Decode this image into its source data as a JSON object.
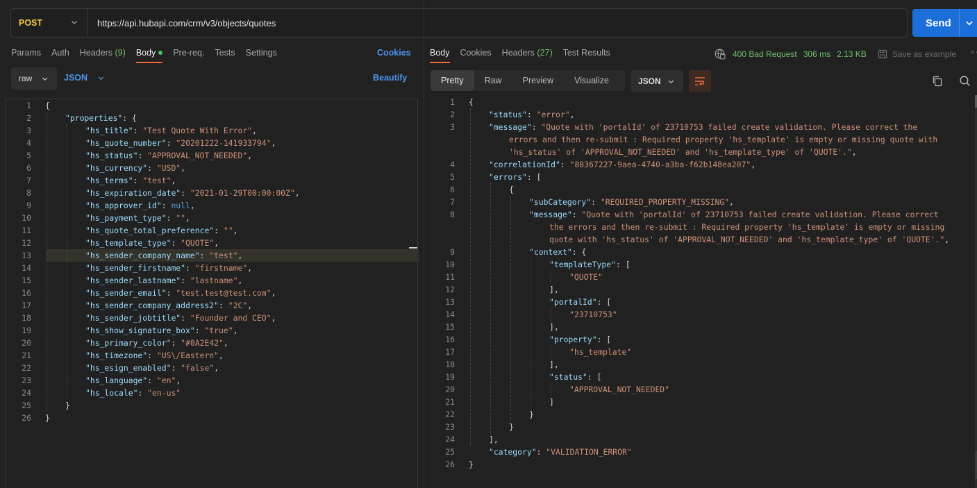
{
  "request": {
    "method": "POST",
    "url": "https://api.hubapi.com/crm/v3/objects/quotes",
    "send_label": "Send"
  },
  "request_tabs": [
    {
      "label": "Params"
    },
    {
      "label": "Auth"
    },
    {
      "label": "Headers",
      "count": "(9)"
    },
    {
      "label": "Body",
      "active": true
    },
    {
      "label": "Pre-req."
    },
    {
      "label": "Tests"
    },
    {
      "label": "Settings"
    }
  ],
  "request_cookies_label": "Cookies",
  "body_mode": "raw",
  "body_format": "JSON",
  "beautify_label": "Beautify",
  "request_body_lines": [
    [
      {
        "t": "punc",
        "v": "{"
      }
    ],
    [
      {
        "t": "key",
        "v": "\"properties\""
      },
      {
        "t": "punc",
        "v": ": {"
      }
    ],
    [
      {
        "t": "key",
        "v": "\"hs_title\""
      },
      {
        "t": "punc",
        "v": ": "
      },
      {
        "t": "str",
        "v": "\"Test Quote With Error\""
      },
      {
        "t": "punc",
        "v": ","
      }
    ],
    [
      {
        "t": "key",
        "v": "\"hs_quote_number\""
      },
      {
        "t": "punc",
        "v": ": "
      },
      {
        "t": "str",
        "v": "\"20201222-141933794\""
      },
      {
        "t": "punc",
        "v": ","
      }
    ],
    [
      {
        "t": "key",
        "v": "\"hs_status\""
      },
      {
        "t": "punc",
        "v": ": "
      },
      {
        "t": "str",
        "v": "\"APPROVAL_NOT_NEEDED\""
      },
      {
        "t": "punc",
        "v": ","
      }
    ],
    [
      {
        "t": "key",
        "v": "\"hs_currency\""
      },
      {
        "t": "punc",
        "v": ": "
      },
      {
        "t": "str",
        "v": "\"USD\""
      },
      {
        "t": "punc",
        "v": ","
      }
    ],
    [
      {
        "t": "key",
        "v": "\"hs_terms\""
      },
      {
        "t": "punc",
        "v": ": "
      },
      {
        "t": "str",
        "v": "\"test\""
      },
      {
        "t": "punc",
        "v": ","
      }
    ],
    [
      {
        "t": "key",
        "v": "\"hs_expiration_date\""
      },
      {
        "t": "punc",
        "v": ": "
      },
      {
        "t": "str",
        "v": "\"2021-01-29T00:00:00Z\""
      },
      {
        "t": "punc",
        "v": ","
      }
    ],
    [
      {
        "t": "key",
        "v": "\"hs_approver_id\""
      },
      {
        "t": "punc",
        "v": ": "
      },
      {
        "t": "kw",
        "v": "null"
      },
      {
        "t": "punc",
        "v": ","
      }
    ],
    [
      {
        "t": "key",
        "v": "\"hs_payment_type\""
      },
      {
        "t": "punc",
        "v": ": "
      },
      {
        "t": "str",
        "v": "\"\""
      },
      {
        "t": "punc",
        "v": ","
      }
    ],
    [
      {
        "t": "key",
        "v": "\"hs_quote_total_preference\""
      },
      {
        "t": "punc",
        "v": ": "
      },
      {
        "t": "str",
        "v": "\"\""
      },
      {
        "t": "punc",
        "v": ","
      }
    ],
    [
      {
        "t": "key",
        "v": "\"hs_template_type\""
      },
      {
        "t": "punc",
        "v": ": "
      },
      {
        "t": "str",
        "v": "\"QUOTE\""
      },
      {
        "t": "punc",
        "v": ","
      }
    ],
    [
      {
        "t": "key",
        "v": "\"hs_sender_company_name\""
      },
      {
        "t": "punc",
        "v": ": "
      },
      {
        "t": "str",
        "v": "\"test\""
      },
      {
        "t": "punc",
        "v": ","
      }
    ],
    [
      {
        "t": "key",
        "v": "\"hs_sender_firstname\""
      },
      {
        "t": "punc",
        "v": ": "
      },
      {
        "t": "str",
        "v": "\"firstname\""
      },
      {
        "t": "punc",
        "v": ","
      }
    ],
    [
      {
        "t": "key",
        "v": "\"hs_sender_lastname\""
      },
      {
        "t": "punc",
        "v": ": "
      },
      {
        "t": "str",
        "v": "\"lastname\""
      },
      {
        "t": "punc",
        "v": ","
      }
    ],
    [
      {
        "t": "key",
        "v": "\"hs_sender_email\""
      },
      {
        "t": "punc",
        "v": ": "
      },
      {
        "t": "str",
        "v": "\"test.test@test.com\""
      },
      {
        "t": "punc",
        "v": ","
      }
    ],
    [
      {
        "t": "key",
        "v": "\"hs_sender_company_address2\""
      },
      {
        "t": "punc",
        "v": ": "
      },
      {
        "t": "str",
        "v": "\"2C\""
      },
      {
        "t": "punc",
        "v": ","
      }
    ],
    [
      {
        "t": "key",
        "v": "\"hs_sender_jobtitle\""
      },
      {
        "t": "punc",
        "v": ": "
      },
      {
        "t": "str",
        "v": "\"Founder and CEO\""
      },
      {
        "t": "punc",
        "v": ","
      }
    ],
    [
      {
        "t": "key",
        "v": "\"hs_show_signature_box\""
      },
      {
        "t": "punc",
        "v": ": "
      },
      {
        "t": "str",
        "v": "\"true\""
      },
      {
        "t": "punc",
        "v": ","
      }
    ],
    [
      {
        "t": "key",
        "v": "\"hs_primary_color\""
      },
      {
        "t": "punc",
        "v": ": "
      },
      {
        "t": "str",
        "v": "\"#0A2E42\""
      },
      {
        "t": "punc",
        "v": ","
      }
    ],
    [
      {
        "t": "key",
        "v": "\"hs_timezone\""
      },
      {
        "t": "punc",
        "v": ": "
      },
      {
        "t": "str",
        "v": "\"US\\/Eastern\""
      },
      {
        "t": "punc",
        "v": ","
      }
    ],
    [
      {
        "t": "key",
        "v": "\"hs_esign_enabled\""
      },
      {
        "t": "punc",
        "v": ": "
      },
      {
        "t": "str",
        "v": "\"false\""
      },
      {
        "t": "punc",
        "v": ","
      }
    ],
    [
      {
        "t": "key",
        "v": "\"hs_language\""
      },
      {
        "t": "punc",
        "v": ": "
      },
      {
        "t": "str",
        "v": "\"en\""
      },
      {
        "t": "punc",
        "v": ","
      }
    ],
    [
      {
        "t": "key",
        "v": "\"hs_locale\""
      },
      {
        "t": "punc",
        "v": ": "
      },
      {
        "t": "str",
        "v": "\"en-us\""
      }
    ],
    [
      {
        "t": "punc",
        "v": "}"
      }
    ],
    [
      {
        "t": "punc",
        "v": "}"
      }
    ]
  ],
  "request_body_indent": [
    0,
    1,
    2,
    2,
    2,
    2,
    2,
    2,
    2,
    2,
    2,
    2,
    2,
    2,
    2,
    2,
    2,
    2,
    2,
    2,
    2,
    2,
    2,
    2,
    1,
    0
  ],
  "response_tabs": [
    {
      "label": "Body",
      "active": true
    },
    {
      "label": "Cookies"
    },
    {
      "label": "Headers",
      "count": "(27)"
    },
    {
      "label": "Test Results"
    }
  ],
  "response_status": {
    "code": "400 Bad Request",
    "time": "306 ms",
    "size": "2.13 KB",
    "save_label": "Save as example"
  },
  "response_view_tabs": [
    {
      "label": "Pretty",
      "active": true
    },
    {
      "label": "Raw"
    },
    {
      "label": "Preview"
    },
    {
      "label": "Visualize"
    }
  ],
  "response_format": "JSON",
  "response_lines": [
    {
      "n": "1",
      "i": 0,
      "p": [
        {
          "t": "punc",
          "v": "{"
        }
      ]
    },
    {
      "n": "2",
      "i": 1,
      "p": [
        {
          "t": "key",
          "v": "\"status\""
        },
        {
          "t": "punc",
          "v": ": "
        },
        {
          "t": "str",
          "v": "\"error\""
        },
        {
          "t": "punc",
          "v": ","
        }
      ]
    },
    {
      "n": "3",
      "i": 1,
      "p": [
        {
          "t": "key",
          "v": "\"message\""
        },
        {
          "t": "punc",
          "v": ": "
        },
        {
          "t": "str",
          "v": "\"Quote with 'portalId' of 23710753 failed create validation. Please correct the"
        }
      ]
    },
    {
      "n": "",
      "i": 2,
      "p": [
        {
          "t": "str",
          "v": "errors and then re-submit : Required property 'hs_template' is empty or missing quote with"
        }
      ]
    },
    {
      "n": "",
      "i": 2,
      "p": [
        {
          "t": "str",
          "v": "'hs_status' of 'APPROVAL_NOT_NEEDED' and 'hs_template_type' of 'QUOTE'.\""
        },
        {
          "t": "punc",
          "v": ","
        }
      ]
    },
    {
      "n": "4",
      "i": 1,
      "p": [
        {
          "t": "key",
          "v": "\"correlationId\""
        },
        {
          "t": "punc",
          "v": ": "
        },
        {
          "t": "str",
          "v": "\"88367227-9aea-4740-a3ba-f62b148ea207\""
        },
        {
          "t": "punc",
          "v": ","
        }
      ]
    },
    {
      "n": "5",
      "i": 1,
      "p": [
        {
          "t": "key",
          "v": "\"errors\""
        },
        {
          "t": "punc",
          "v": ": ["
        }
      ]
    },
    {
      "n": "6",
      "i": 2,
      "p": [
        {
          "t": "punc",
          "v": "{"
        }
      ]
    },
    {
      "n": "7",
      "i": 3,
      "p": [
        {
          "t": "key",
          "v": "\"subCategory\""
        },
        {
          "t": "punc",
          "v": ": "
        },
        {
          "t": "str",
          "v": "\"REQUIRED_PROPERTY_MISSING\""
        },
        {
          "t": "punc",
          "v": ","
        }
      ]
    },
    {
      "n": "8",
      "i": 3,
      "p": [
        {
          "t": "key",
          "v": "\"message\""
        },
        {
          "t": "punc",
          "v": ": "
        },
        {
          "t": "str",
          "v": "\"Quote with 'portalId' of 23710753 failed create validation. Please correct"
        }
      ]
    },
    {
      "n": "",
      "i": 4,
      "p": [
        {
          "t": "str",
          "v": "the errors and then re-submit : Required property 'hs_template' is empty or missing"
        }
      ]
    },
    {
      "n": "",
      "i": 4,
      "p": [
        {
          "t": "str",
          "v": "quote with 'hs_status' of 'APPROVAL_NOT_NEEDED' and 'hs_template_type' of 'QUOTE'.\""
        },
        {
          "t": "punc",
          "v": ","
        }
      ]
    },
    {
      "n": "9",
      "i": 3,
      "p": [
        {
          "t": "key",
          "v": "\"context\""
        },
        {
          "t": "punc",
          "v": ": {"
        }
      ]
    },
    {
      "n": "10",
      "i": 4,
      "p": [
        {
          "t": "key",
          "v": "\"templateType\""
        },
        {
          "t": "punc",
          "v": ": ["
        }
      ]
    },
    {
      "n": "11",
      "i": 5,
      "p": [
        {
          "t": "str",
          "v": "\"QUOTE\""
        }
      ]
    },
    {
      "n": "12",
      "i": 4,
      "p": [
        {
          "t": "punc",
          "v": "],"
        }
      ]
    },
    {
      "n": "13",
      "i": 4,
      "p": [
        {
          "t": "key",
          "v": "\"portalId\""
        },
        {
          "t": "punc",
          "v": ": ["
        }
      ]
    },
    {
      "n": "14",
      "i": 5,
      "p": [
        {
          "t": "str",
          "v": "\"23710753\""
        }
      ]
    },
    {
      "n": "15",
      "i": 4,
      "p": [
        {
          "t": "punc",
          "v": "],"
        }
      ]
    },
    {
      "n": "16",
      "i": 4,
      "p": [
        {
          "t": "key",
          "v": "\"property\""
        },
        {
          "t": "punc",
          "v": ": ["
        }
      ]
    },
    {
      "n": "17",
      "i": 5,
      "p": [
        {
          "t": "str",
          "v": "\"hs_template\""
        }
      ]
    },
    {
      "n": "18",
      "i": 4,
      "p": [
        {
          "t": "punc",
          "v": "],"
        }
      ]
    },
    {
      "n": "19",
      "i": 4,
      "p": [
        {
          "t": "key",
          "v": "\"status\""
        },
        {
          "t": "punc",
          "v": ": ["
        }
      ]
    },
    {
      "n": "20",
      "i": 5,
      "p": [
        {
          "t": "str",
          "v": "\"APPROVAL_NOT_NEEDED\""
        }
      ]
    },
    {
      "n": "21",
      "i": 4,
      "p": [
        {
          "t": "punc",
          "v": "]"
        }
      ]
    },
    {
      "n": "22",
      "i": 3,
      "p": [
        {
          "t": "punc",
          "v": "}"
        }
      ]
    },
    {
      "n": "23",
      "i": 2,
      "p": [
        {
          "t": "punc",
          "v": "}"
        }
      ]
    },
    {
      "n": "24",
      "i": 1,
      "p": [
        {
          "t": "punc",
          "v": "],"
        }
      ]
    },
    {
      "n": "25",
      "i": 1,
      "p": [
        {
          "t": "key",
          "v": "\"category\""
        },
        {
          "t": "punc",
          "v": ": "
        },
        {
          "t": "str",
          "v": "\"VALIDATION_ERROR\""
        }
      ]
    },
    {
      "n": "26",
      "i": 0,
      "p": [
        {
          "t": "punc",
          "v": "}"
        }
      ]
    }
  ]
}
